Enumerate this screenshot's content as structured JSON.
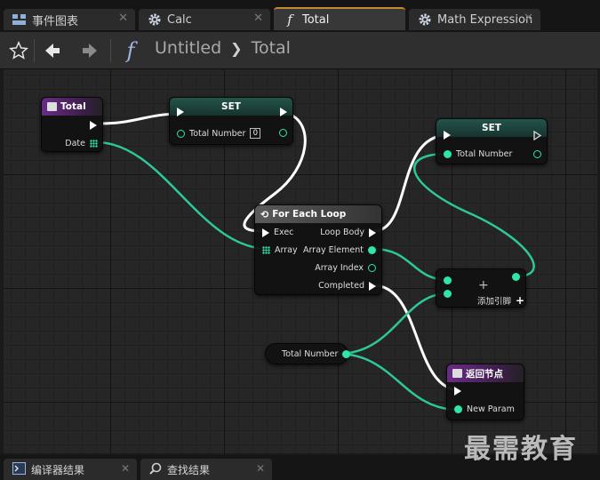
{
  "tabs": [
    {
      "label": "事件图表",
      "icon": "event-graph-icon",
      "active": false
    },
    {
      "label": "Calc",
      "icon": "gear-icon",
      "active": false
    },
    {
      "label": "Total",
      "icon": "function-icon",
      "active": true
    },
    {
      "label": "Math Expression",
      "icon": "gear-icon",
      "active": false
    }
  ],
  "toolbar": {
    "breadcrumb_root": "Untitled",
    "breadcrumb_current": "Total"
  },
  "nodes": {
    "entry": {
      "title": "Total",
      "date_label": "Date"
    },
    "set1": {
      "title": "SET",
      "pin_label": "Total Number",
      "pin_value": "0"
    },
    "set2": {
      "title": "SET",
      "pin_label": "Total Number"
    },
    "foreach": {
      "title": "For Each Loop",
      "exec": "Exec",
      "array": "Array",
      "loop_body": "Loop Body",
      "array_element": "Array Element",
      "array_index": "Array Index",
      "completed": "Completed"
    },
    "add": {
      "symbol": "+",
      "add_pin": "添加引脚"
    },
    "getter": {
      "label": "Total Number"
    },
    "ret": {
      "title": "返回节点",
      "param": "New Param"
    }
  },
  "bottom_tabs": [
    {
      "label": "编译器结果",
      "icon": "compiler-results-icon"
    },
    {
      "label": "查找结果",
      "icon": "search-icon"
    }
  ],
  "watermark": "最需教育",
  "colors": {
    "exec_wire": "#ffffff",
    "data_wire": "#2ec79a",
    "pin_teal": "#2ee6a7",
    "active_tab_accent": "#c28b2b"
  }
}
